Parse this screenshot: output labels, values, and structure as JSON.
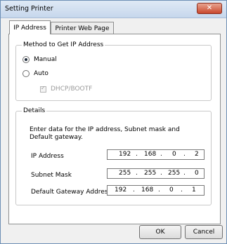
{
  "window": {
    "title": "Setting Printer",
    "close_symbol": "✕"
  },
  "tabs": [
    {
      "label": "IP Address",
      "active": true
    },
    {
      "label": "Printer Web Page",
      "active": false
    }
  ],
  "method": {
    "legend": "Method to Get IP Address",
    "options": [
      {
        "label": "Manual",
        "selected": true
      },
      {
        "label": "Auto",
        "selected": false
      }
    ],
    "dhcp": {
      "label": "DHCP/BOOTF",
      "checked": true,
      "disabled": true
    }
  },
  "details": {
    "legend": "Details",
    "description": "Enter data for the IP address, Subnet mask and Default gateway.",
    "fields": [
      {
        "label": "IP Address",
        "octets": [
          "192",
          "168",
          "0",
          "2"
        ]
      },
      {
        "label": "Subnet Mask",
        "octets": [
          "255",
          "255",
          "255",
          "0"
        ]
      },
      {
        "label": "Default Gateway Address",
        "octets": [
          "192",
          "168",
          "0",
          "1"
        ]
      }
    ]
  },
  "buttons": {
    "ok": "OK",
    "cancel": "Cancel"
  },
  "colors": {
    "close_button": "#c9472c",
    "title_bar": "#c6d7ec"
  }
}
